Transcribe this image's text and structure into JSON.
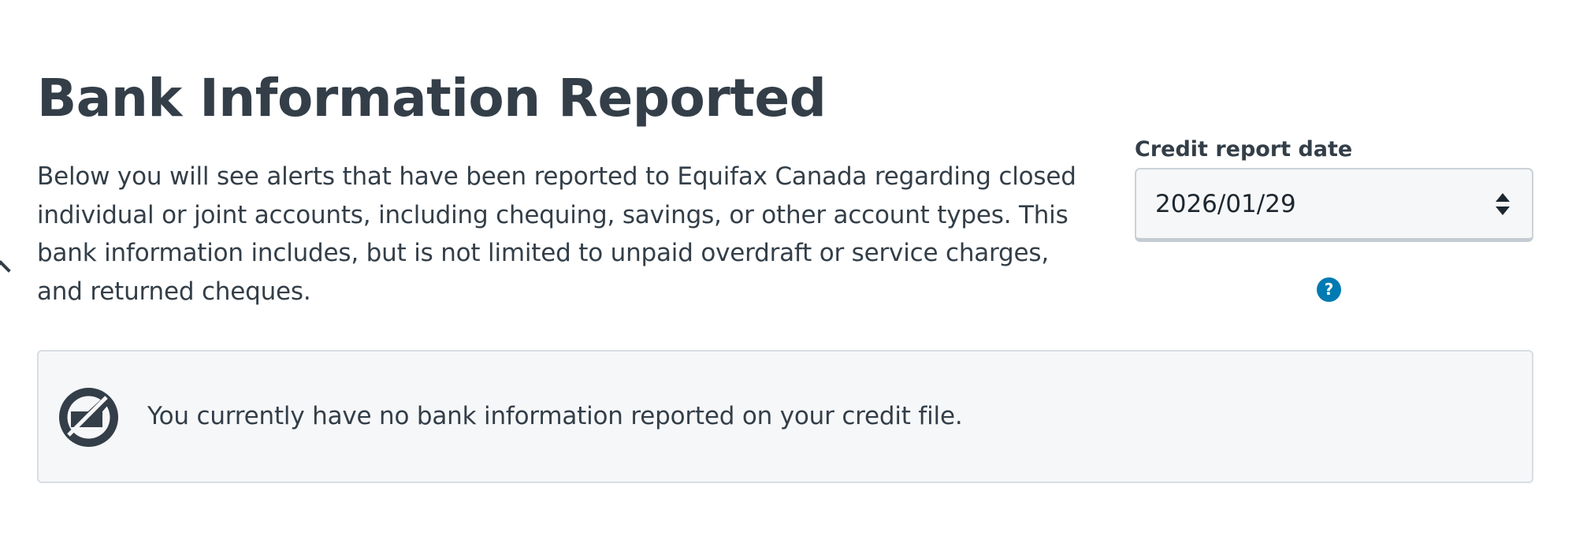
{
  "header": {
    "title": "Bank Information Reported"
  },
  "intro": {
    "text": "Below you will see alerts that have been reported to Equifax Canada regarding closed individual or joint accounts, including chequing, savings, or other account types. This bank information includes, but is not limited to unpaid overdraft or service charges, and returned cheques."
  },
  "report_date": {
    "label": "Credit report date",
    "selected": "2026/01/29",
    "help_glyph": "?"
  },
  "notice": {
    "message": "You currently have no bank information reported on your credit file."
  },
  "icons": {
    "sort": "sort-arrows-icon",
    "help": "help-icon",
    "empty_state": "no-records-icon",
    "chevron": "chevron-up-icon"
  },
  "colors": {
    "text": "#333e48",
    "accent": "#007ab3",
    "panel_background": "#f6f7f9",
    "panel_border": "#d8dde2"
  }
}
